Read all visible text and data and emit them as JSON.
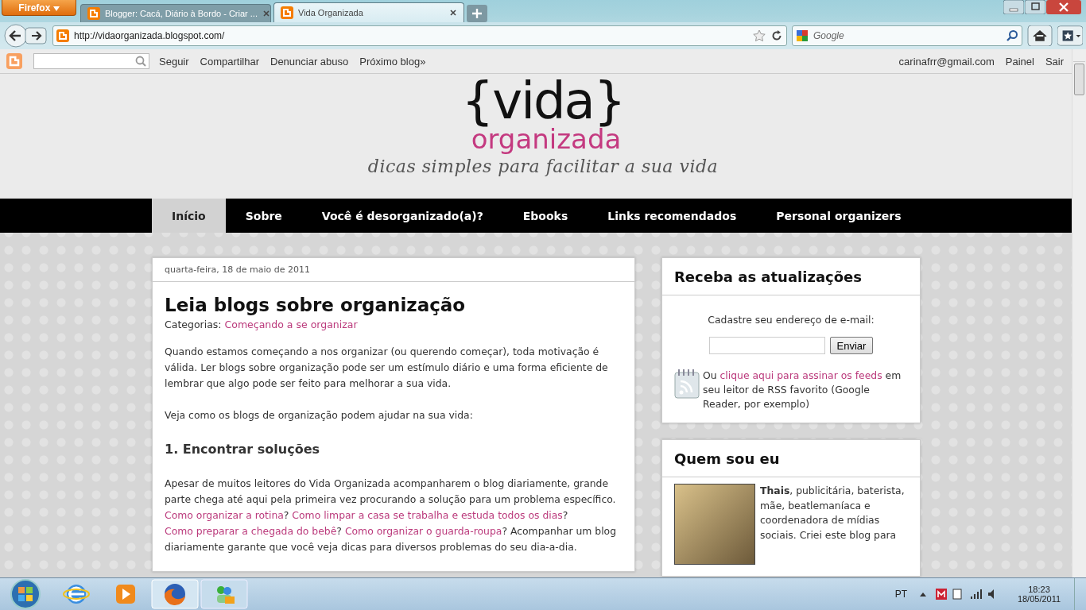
{
  "browser": {
    "menu_button": "Firefox",
    "tabs": [
      {
        "title": "Blogger: Cacá, Diário à Bordo - Criar ...",
        "selected": false
      },
      {
        "title": "Vida Organizada",
        "selected": true
      }
    ],
    "url": "http://vidaorganizada.blogspot.com/",
    "search_placeholder": "Google"
  },
  "blogger_bar": {
    "links": [
      "Seguir",
      "Compartilhar",
      "Denunciar abuso",
      "Próximo blog»"
    ],
    "account": "carinafrr@gmail.com",
    "user_links": [
      "Painel",
      "Sair"
    ]
  },
  "header": {
    "logo_main": "{vida}",
    "logo_sub": "organizada",
    "tagline": "dicas simples para facilitar a sua vida"
  },
  "nav": [
    {
      "label": "Início",
      "selected": true
    },
    {
      "label": "Sobre",
      "selected": false
    },
    {
      "label": "Você é desorganizado(a)?",
      "selected": false
    },
    {
      "label": "Ebooks",
      "selected": false
    },
    {
      "label": "Links recomendados",
      "selected": false
    },
    {
      "label": "Personal organizers",
      "selected": false
    }
  ],
  "post": {
    "date": "quarta-feira, 18 de maio de 2011",
    "title": "Leia blogs sobre organização",
    "category_label": "Categorias:",
    "category": "Começando a se organizar",
    "blocks": [
      {
        "kind": "paragraph",
        "segments": [
          {
            "text": "Quando estamos começando a nos organizar (ou querendo começar), toda motivação é válida. Ler blogs sobre organização pode ser um estímulo diário e uma forma eficiente de lembrar que algo pode ser feito para melhorar a sua vida.",
            "link": false
          }
        ]
      },
      {
        "kind": "paragraph",
        "segments": [
          {
            "text": "Veja como os blogs de organização podem ajudar na sua vida:",
            "link": false
          }
        ]
      },
      {
        "kind": "heading",
        "text": "1. Encontrar soluções"
      },
      {
        "kind": "paragraph",
        "segments": [
          {
            "text": "Apesar de muitos leitores do Vida Organizada acompanharem o blog diariamente, grande parte chega até aqui pela primeira vez procurando a solução para um problema específico. ",
            "link": false
          },
          {
            "text": "Como organizar a rotina",
            "link": true
          },
          {
            "text": "? ",
            "link": false
          },
          {
            "text": "Como limpar a casa se trabalha e estuda todos os dias",
            "link": true
          },
          {
            "text": "? ",
            "link": false
          },
          {
            "text": "Como preparar a chegada do bebê",
            "link": true
          },
          {
            "text": "? ",
            "link": false
          },
          {
            "text": "Como organizar o guarda-roupa",
            "link": true
          },
          {
            "text": "? Acompanhar um blog diariamente garante que você veja dicas para diversos problemas do seu dia-a-dia.",
            "link": false
          }
        ]
      }
    ]
  },
  "sidebar": {
    "subscribe": {
      "title": "Receba as atualizações",
      "label": "Cadastre seu endereço de e-mail:",
      "button": "Enviar",
      "rss": [
        {
          "text": "Ou ",
          "link": false
        },
        {
          "text": "clique aqui para assinar os feeds",
          "link": true
        },
        {
          "text": " em seu leitor de RSS favorito (Google Reader, por exemplo)",
          "link": false
        }
      ]
    },
    "about": {
      "title": "Quem sou eu",
      "bio": "**Thais**, publicitária, baterista, mãe, beatlemaníaca e coordenadora de mídias sociais. Criei este blog para"
    }
  },
  "taskbar": {
    "language": "PT",
    "time": "18:23",
    "date": "18/05/2011"
  }
}
